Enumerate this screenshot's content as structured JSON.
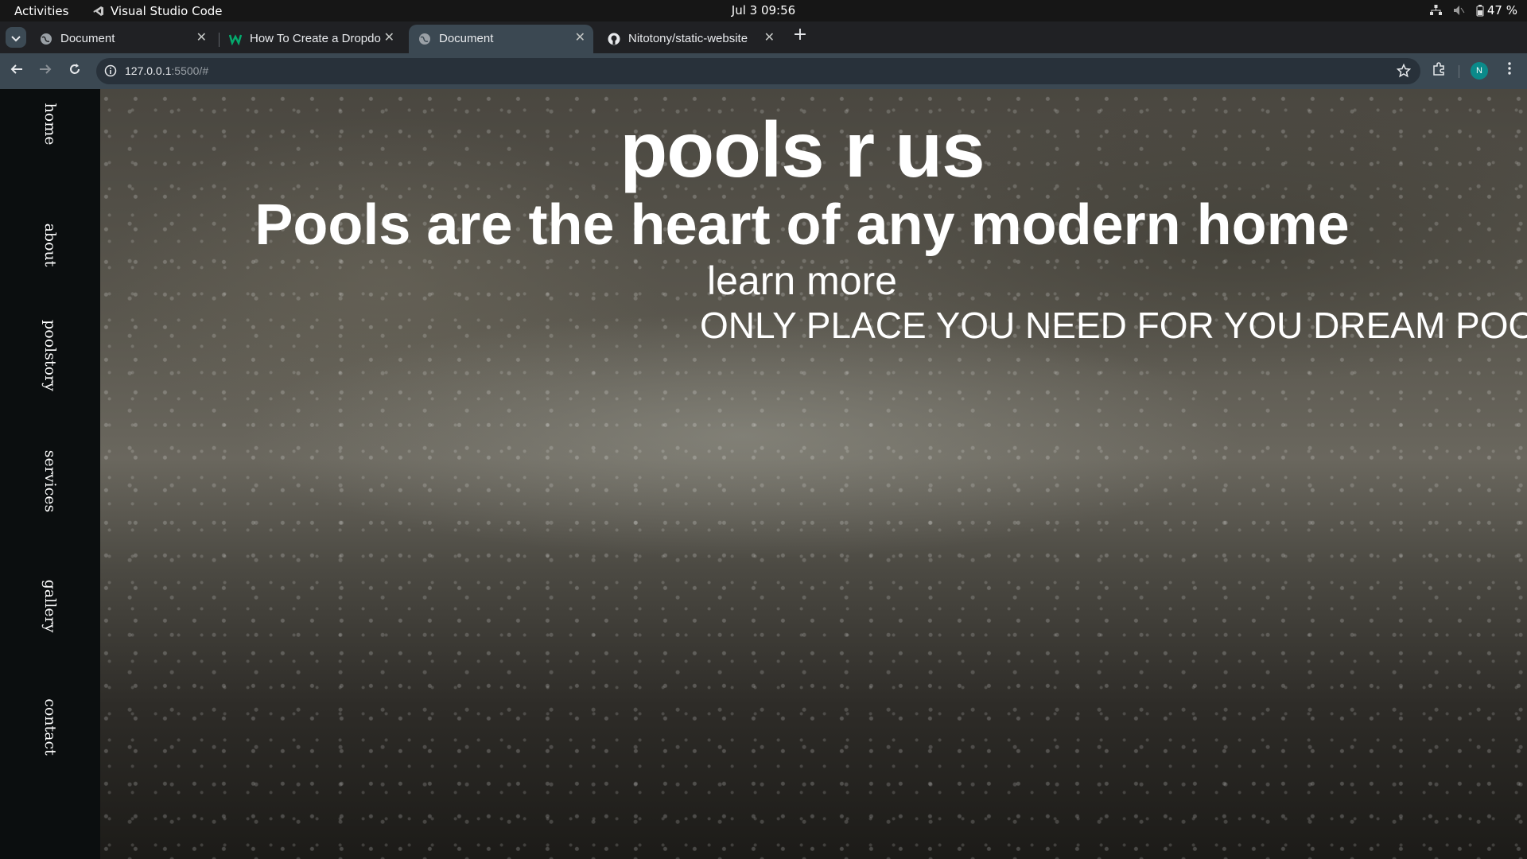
{
  "system_bar": {
    "activities": "Activities",
    "app_name": "Visual Studio Code",
    "clock": "Jul 3  09:56",
    "battery": "47 %"
  },
  "browser": {
    "tabs": [
      {
        "title": "Document",
        "favicon": "globe-icon",
        "active": false
      },
      {
        "title": "How To Create a Dropdo",
        "favicon": "w3schools-icon",
        "active": false
      },
      {
        "title": "Document",
        "favicon": "globe-icon",
        "active": true
      },
      {
        "title": "Nitotony/static-website",
        "favicon": "github-icon",
        "active": false
      }
    ],
    "new_tab_label": "+",
    "url_host": "127.0.0.1",
    "url_rest": ":5500/#",
    "profile_initial": "N"
  },
  "page": {
    "nav": [
      {
        "label": "home"
      },
      {
        "label": "about"
      },
      {
        "label": "poolstory"
      },
      {
        "label": "services"
      },
      {
        "label": "gallery"
      },
      {
        "label": "contact"
      }
    ],
    "site_title": "pools r us",
    "tagline": "Pools are the heart of any modern home",
    "learn_more": "learn more",
    "marquee": "ONLY PLACE YOU NEED FOR YOU DREAM POOL"
  },
  "colors": {
    "sidebar_bg": "#0b0e0f",
    "tab_strip_bg": "#202124",
    "toolbar_bg": "#3b4852",
    "text": "#ffffff"
  }
}
